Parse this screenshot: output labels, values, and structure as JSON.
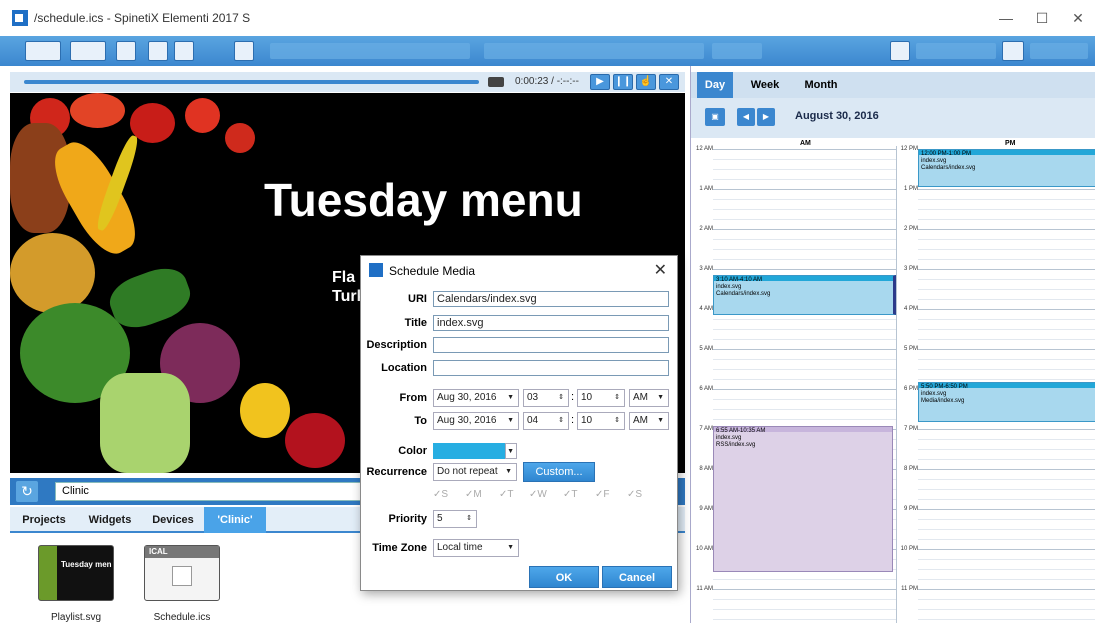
{
  "window": {
    "title": "/schedule.ics - SpinetiX Elementi 2017 S",
    "minimize": "—",
    "maximize": "☐",
    "close": "✕"
  },
  "player": {
    "time": "0:00:23 / -:--:--"
  },
  "preview": {
    "headline": "Tuesday menu",
    "sub_line1": "Fla",
    "sub_line2": "Turke"
  },
  "search": {
    "value": "Clinic"
  },
  "tabs": [
    {
      "label": "Projects"
    },
    {
      "label": "Widgets"
    },
    {
      "label": "Devices"
    },
    {
      "label": "'Clinic'"
    }
  ],
  "assets": [
    {
      "label": "Playlist.svg",
      "thumb_text": "Tuesday men"
    },
    {
      "label": "Schedule.ics",
      "badge": "ICAL"
    }
  ],
  "calendar": {
    "views": [
      {
        "label": "Day"
      },
      {
        "label": "Week"
      },
      {
        "label": "Month"
      }
    ],
    "date": "August 30, 2016",
    "am_label": "AM",
    "pm_label": "PM",
    "am_hours": [
      "12 AM",
      "1 AM",
      "2 AM",
      "3 AM",
      "4 AM",
      "5 AM",
      "6 AM",
      "7 AM",
      "8 AM",
      "9 AM",
      "10 AM",
      "11 AM"
    ],
    "pm_hours": [
      "12 PM",
      "1 PM",
      "2 PM",
      "3 PM",
      "4 PM",
      "5 PM",
      "6 PM",
      "7 PM",
      "8 PM",
      "9 PM",
      "10 PM",
      "11 PM"
    ],
    "events": [
      {
        "time": "3:10 AM-4:10 AM",
        "title": "index.svg",
        "uri": "Calendars/index.svg"
      },
      {
        "time": "6:55 AM-10:35 AM",
        "title": "index.svg",
        "uri": "RSS/index.svg"
      },
      {
        "time": "12:00 PM-1:00 PM",
        "title": "index.svg",
        "uri": "Calendars/index.svg"
      },
      {
        "time": "5:50 PM-6:50 PM",
        "title": "index.svg",
        "uri": "Media/index.svg"
      }
    ]
  },
  "dialog": {
    "title": "Schedule Media",
    "uri_label": "URI",
    "uri_value": "Calendars/index.svg",
    "title_label": "Title",
    "title_value": "index.svg",
    "description_label": "Description",
    "description_value": "",
    "location_label": "Location",
    "location_value": "",
    "from_label": "From",
    "from_date": "Aug 30, 2016",
    "from_hour": "03",
    "from_minute": "10",
    "from_ampm": "AM",
    "to_label": "To",
    "to_date": "Aug 30, 2016",
    "to_hour": "04",
    "to_minute": "10",
    "to_ampm": "AM",
    "color_label": "Color",
    "color_value": "#27aee2",
    "recurrence_label": "Recurrence",
    "recurrence_value": "Do not repeat",
    "custom_button": "Custom...",
    "days": [
      "S",
      "M",
      "T",
      "W",
      "T",
      "F",
      "S"
    ],
    "priority_label": "Priority",
    "priority_value": "5",
    "timezone_label": "Time Zone",
    "timezone_value": "Local time",
    "ok_button": "OK",
    "cancel_button": "Cancel"
  }
}
